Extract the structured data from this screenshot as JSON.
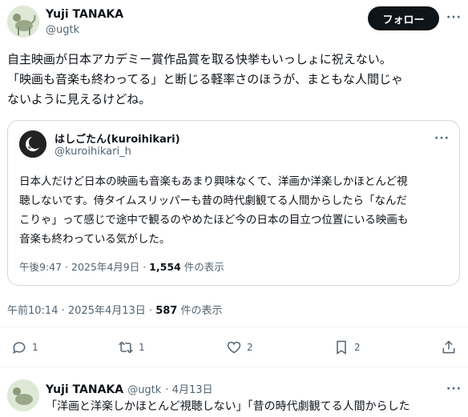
{
  "main_tweet": {
    "author_name": "Yuji TANAKA",
    "author_handle": "@ugtk",
    "follow_label": "フォロー",
    "text_lines": [
      "自主映画が日本アカデミー賞作品賞を取る快挙もいっしょに祝えない。",
      "「映画も音楽も終わってる」と断じる軽率さのほうが、まともな人間じゃ",
      "ないように見えるけどね。"
    ],
    "time": "午前10:14",
    "date": "2025年4月13日",
    "views_count": "587",
    "views_label": "件の表示"
  },
  "quoted_tweet": {
    "author_name": "はしごたん(kuroihikari)",
    "author_handle": "@kuroihikari_h",
    "more_label": "···",
    "text_lines": [
      "日本人だけど日本の映画も音楽もあまり興味なくて、洋画か洋楽しかほとんど視",
      "聴しないです。侍タイムスリッパーも昔の時代劇観てる人間からしたら「なんだ",
      "こりゃ」って感じで途中で観るのやめたほど今の日本の目立つ位置にいる映画も",
      "音楽も終わっている気がした。"
    ],
    "time": "午後9:47",
    "date": "2025年4月9日",
    "views_count": "1,554",
    "views_label": "件の表示"
  },
  "actions": {
    "reply_count": "1",
    "retweet_count": "1",
    "like_count": "2",
    "bookmark_count": "2"
  },
  "reply_tweet": {
    "author_name": "Yuji TANAKA",
    "author_handle": "@ugtk",
    "date": "· 4月13日",
    "text_partial": "「洋画と洋楽しかほとんど視聴しない」「昔の時代劇観てる人間からした"
  },
  "colors": {
    "text": "#0f1419",
    "secondary": "#536471",
    "border": "#cfd9de"
  }
}
